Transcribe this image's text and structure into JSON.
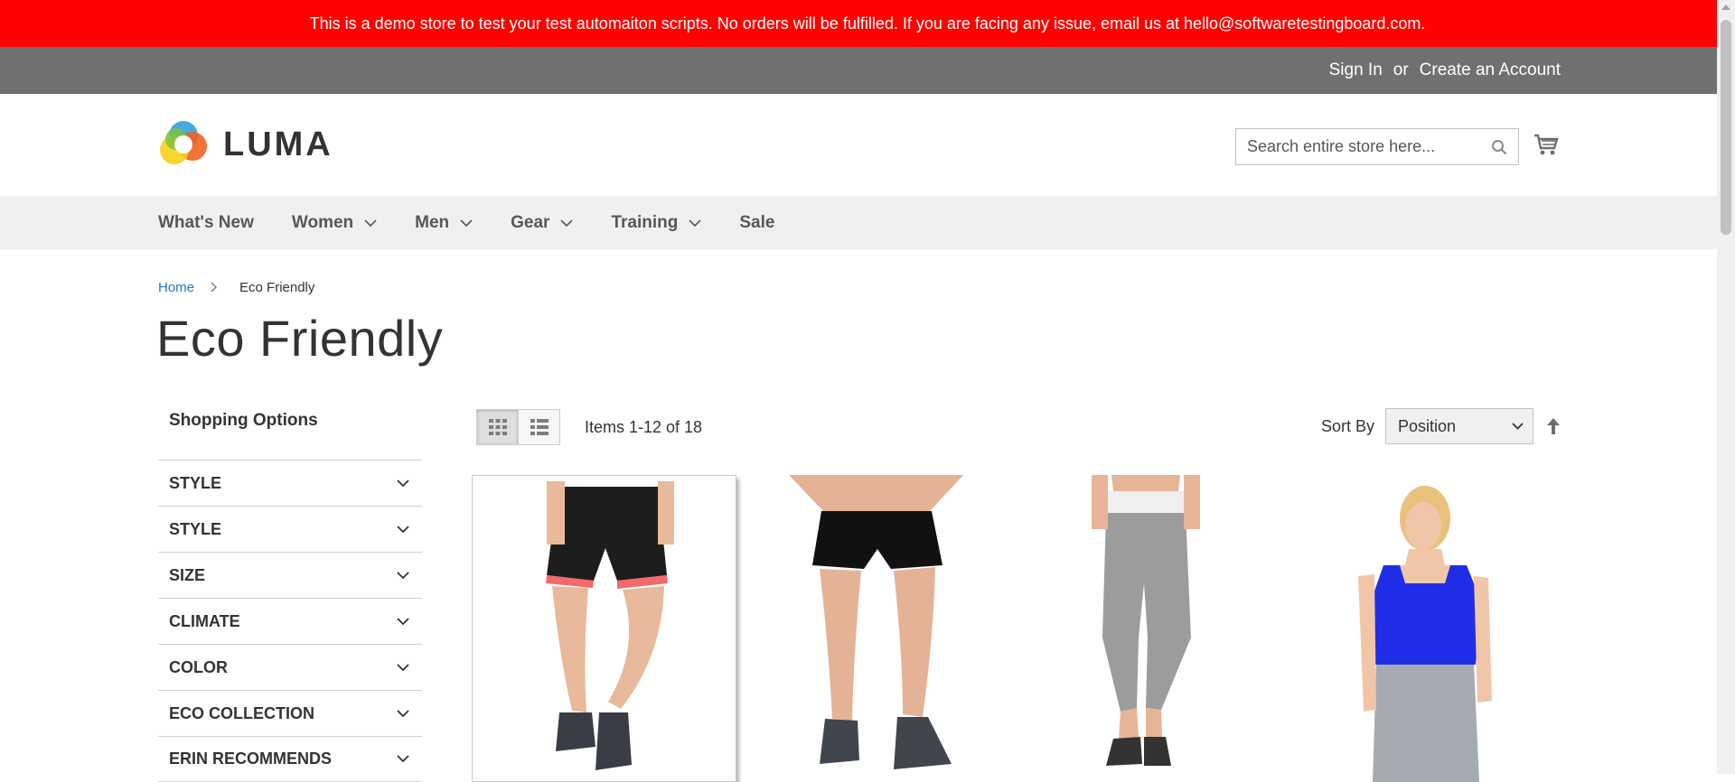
{
  "demo_banner": "This is a demo store to test your test automaiton scripts. No orders will be fulfilled. If you are facing any issue, email us at hello@softwaretestingboard.com.",
  "top_links": {
    "sign_in": "Sign In",
    "or": "or",
    "create_account": "Create an Account"
  },
  "logo": {
    "text": "LUMA"
  },
  "search": {
    "placeholder": "Search entire store here..."
  },
  "nav": [
    {
      "label": "What's New",
      "has_menu": false
    },
    {
      "label": "Women",
      "has_menu": true
    },
    {
      "label": "Men",
      "has_menu": true
    },
    {
      "label": "Gear",
      "has_menu": true
    },
    {
      "label": "Training",
      "has_menu": true
    },
    {
      "label": "Sale",
      "has_menu": false
    }
  ],
  "breadcrumb": {
    "home": "Home",
    "current": "Eco Friendly"
  },
  "page_title": "Eco Friendly",
  "sidebar": {
    "title": "Shopping Options",
    "filters": [
      "Style",
      "Style",
      "Size",
      "Climate",
      "Color",
      "Eco Collection",
      "Erin Recommends"
    ]
  },
  "toolbar": {
    "amount": "Items 1-12 of 18",
    "sort_label": "Sort By",
    "sort_value": "Position"
  },
  "products": [
    {
      "image": "black shorts with coral liner"
    },
    {
      "image": "black running shorts"
    },
    {
      "image": "grey capri leggings"
    },
    {
      "image": "blue tank top"
    }
  ],
  "colors": {
    "banner": "#ff0101",
    "topbar": "#6e716e",
    "nav_bg": "#f0f0f0",
    "link": "#1979c3"
  }
}
